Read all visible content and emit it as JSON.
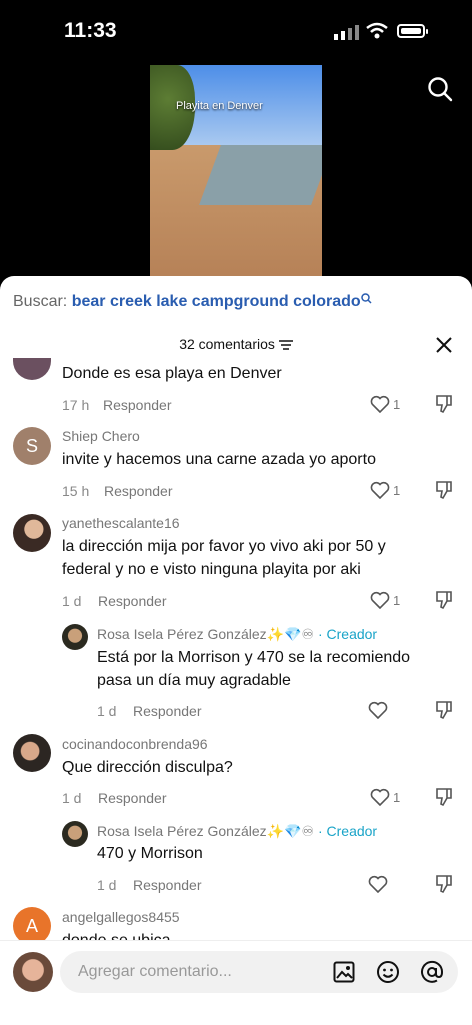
{
  "status": {
    "time": "11:33"
  },
  "video": {
    "caption": "Playita en Denver"
  },
  "search": {
    "prefix": "Buscar:",
    "query": "bear creek lake campground colorado"
  },
  "comments_header": {
    "count_label": "32 comentarios"
  },
  "comments": [
    {
      "text": "Donde es esa playa en Denver",
      "time": "17 h",
      "reply": "Responder",
      "likes": "1"
    },
    {
      "user": "Shiep Chero",
      "avatar_letter": "S",
      "text": "invite y hacemos una carne azada yo aporto",
      "time": "15 h",
      "reply": "Responder",
      "likes": "1"
    },
    {
      "user": "yanethescalante16",
      "text": "la dirección mija por favor yo vivo aki por 50 y federal y no e visto ninguna playita por aki",
      "time": "1 d",
      "reply": "Responder",
      "likes": "1"
    },
    {
      "user": "Rosa Isela Pérez González✨💎♾",
      "creator": "· Creador",
      "text": "Está por la Morrison y 470 se la recomiendo pasa un día muy agradable",
      "time": "1 d",
      "reply": "Responder"
    },
    {
      "user": "cocinandoconbrenda96",
      "text": "Que dirección disculpa?",
      "time": "1 d",
      "reply": "Responder",
      "likes": "1"
    },
    {
      "user": "Rosa Isela Pérez González✨💎♾",
      "creator": "· Creador",
      "text": "470 y Morrison",
      "time": "1 d",
      "reply": "Responder"
    },
    {
      "user": "angelgallegos8455",
      "avatar_letter": "A",
      "text": "donde se ubica"
    }
  ],
  "input": {
    "placeholder": "Agregar comentario..."
  },
  "colors": {
    "accent": "#2a5db0",
    "creator": "#1aa4c8",
    "avatar_s": "#a0806b",
    "avatar_a": "#e8742a"
  }
}
